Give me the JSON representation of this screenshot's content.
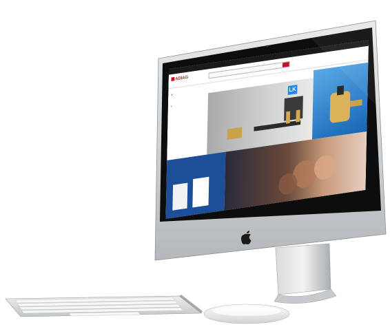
{
  "scene": {
    "description_free": true,
    "imac": {
      "logo_icon": "apple-logo-icon"
    },
    "keyboard": {
      "icon": "keyboard-icon"
    },
    "mouse": {
      "icon": "mouse-icon"
    }
  },
  "website": {
    "logo": "ADIAG",
    "topbar_links": "",
    "nav": "",
    "promo": "",
    "hero_title": "",
    "hero_badge": "LK",
    "side_promo_title": "",
    "bottom_left_title": "",
    "bottom_mid_title": "",
    "bottom_mid_tag": ""
  },
  "colors": {
    "brand_red": "#c8102e",
    "banner_blue": "#1766b5",
    "dark_blue": "#1c4e9a",
    "bezel": "#0d0d0d",
    "aluminum": "#cfd3d6"
  }
}
